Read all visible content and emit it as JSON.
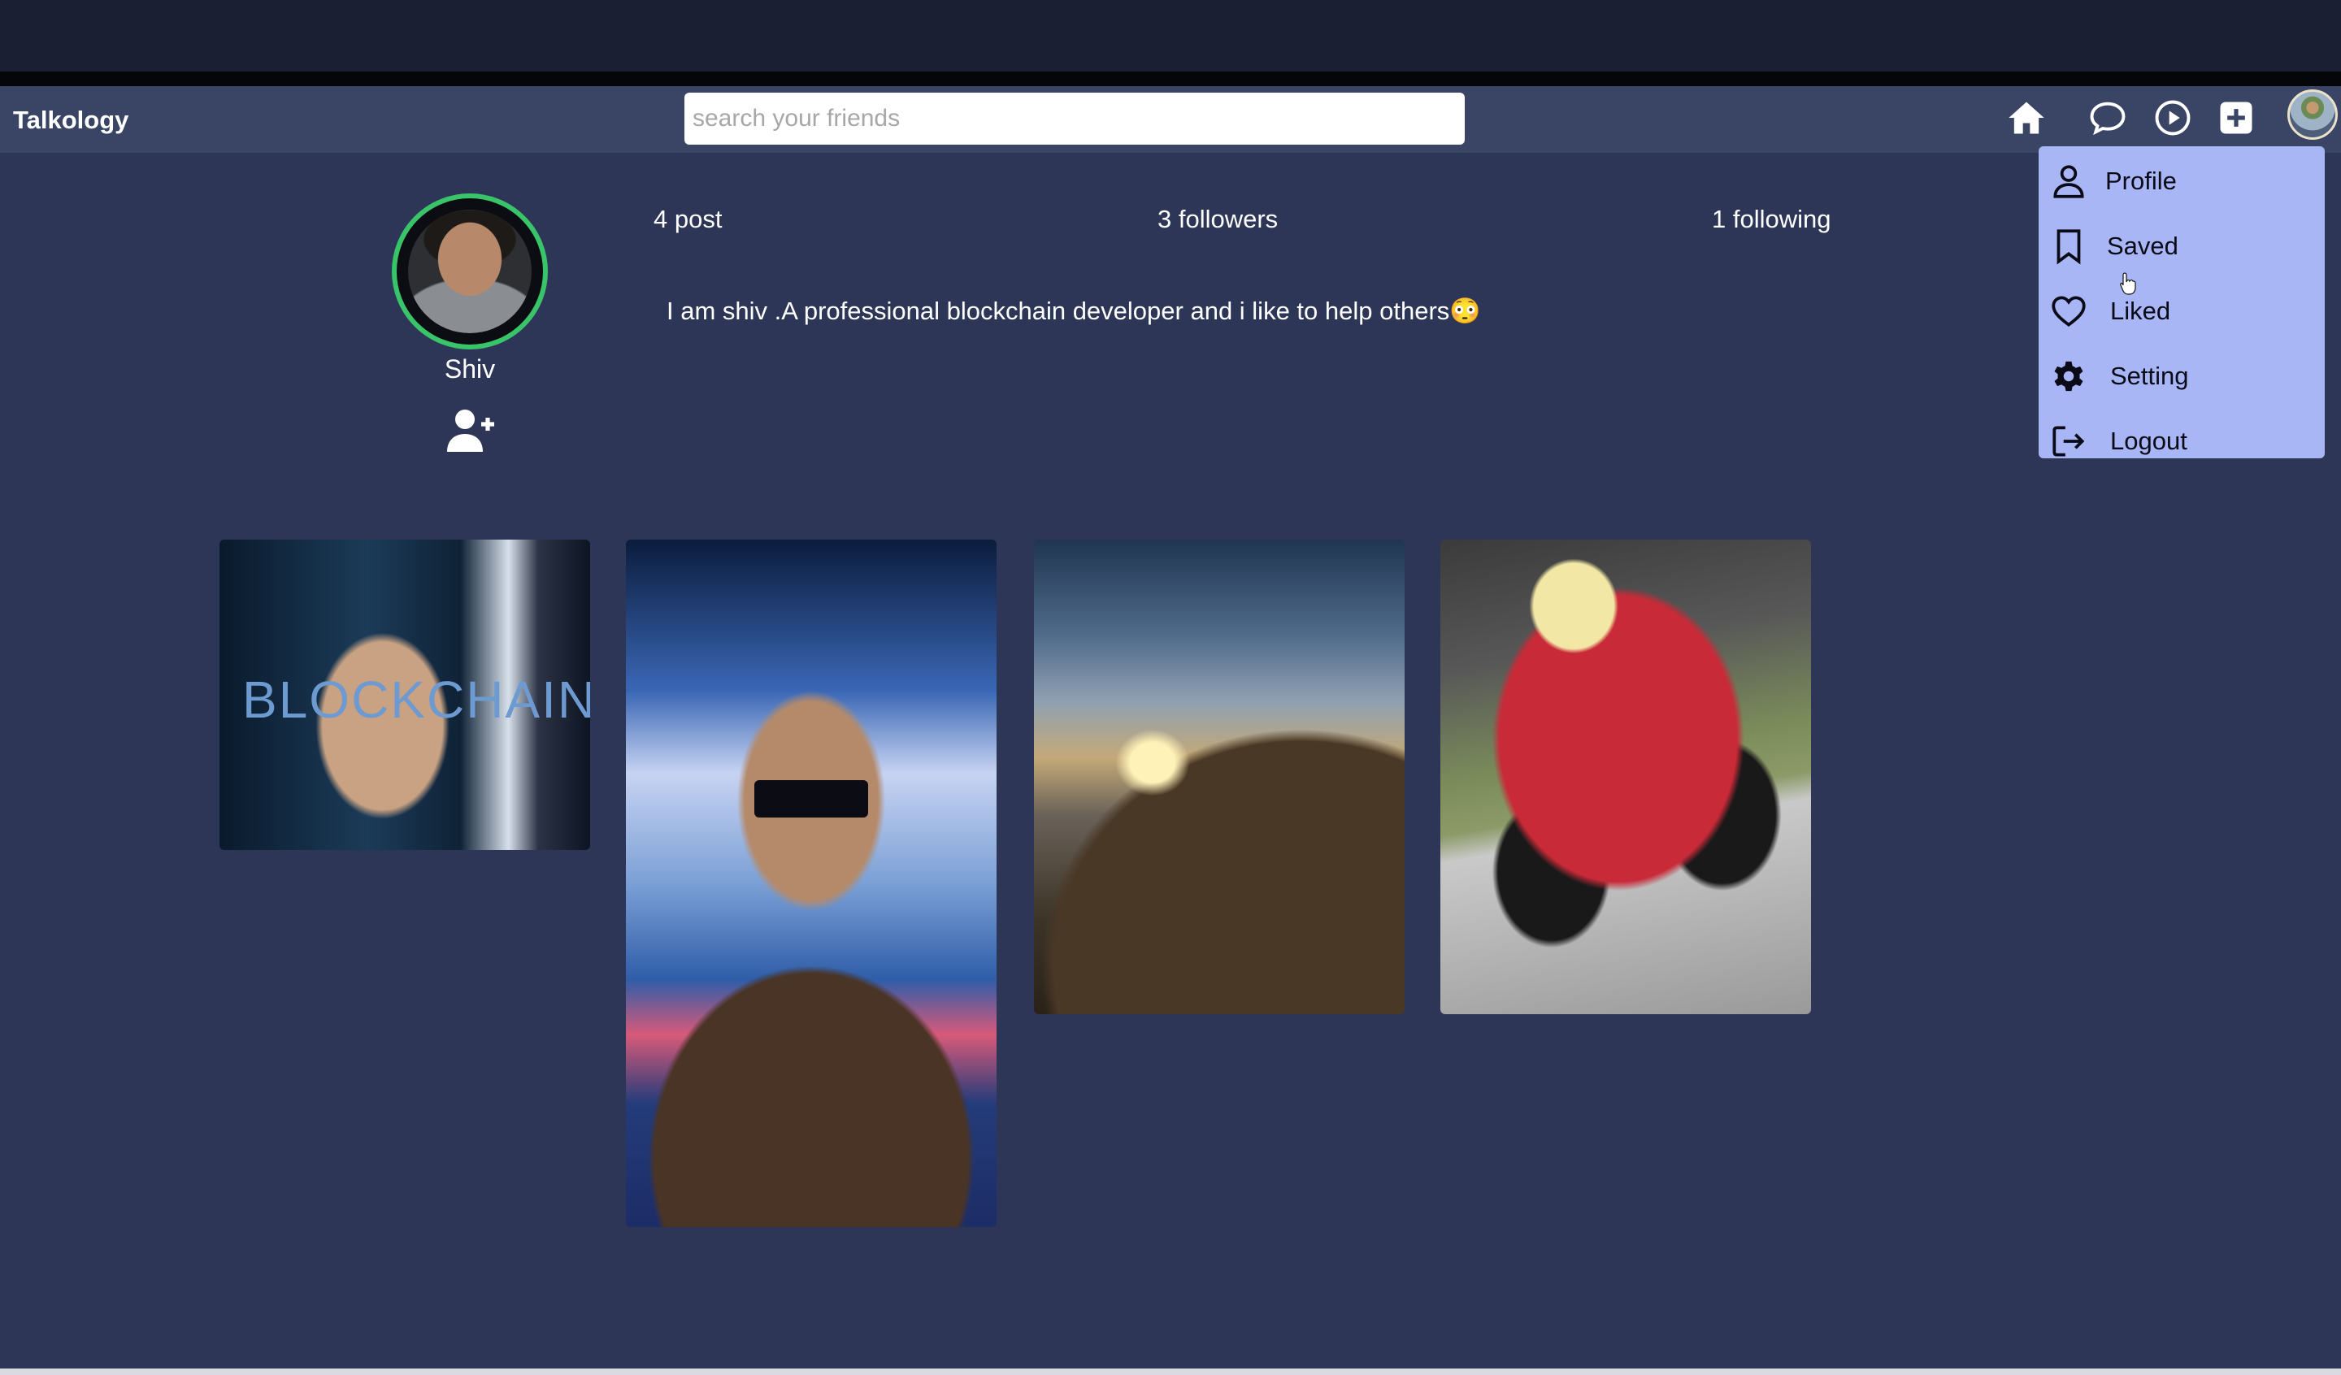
{
  "app": {
    "brand": "Talkology"
  },
  "search": {
    "placeholder": "search your friends",
    "value": ""
  },
  "nav": {
    "icons": [
      "home-icon",
      "chat-icon",
      "play-icon",
      "add-post-icon"
    ],
    "avatar": "user-avatar"
  },
  "menu": {
    "items": [
      {
        "label": "Profile",
        "icon": "user-icon"
      },
      {
        "label": "Saved",
        "icon": "bookmark-icon"
      },
      {
        "label": "Liked",
        "icon": "heart-icon"
      },
      {
        "label": "Setting",
        "icon": "gear-icon"
      },
      {
        "label": "Logout",
        "icon": "logout-icon"
      }
    ]
  },
  "profile": {
    "name": "Shiv",
    "posts": "4 post",
    "followers": "3 followers",
    "following": "1 following",
    "bio": "I am shiv .A professional blockchain developer and i like to help others😳",
    "follow_icon": "add-friend-icon"
  },
  "posts": [
    {
      "caption": "BLOCKCHAIN"
    },
    {},
    {},
    {}
  ],
  "colors": {
    "background": "#2d3656",
    "navbar": "#3a4464",
    "menu": "#a9b6f5",
    "avatar_ring": "#39c46a"
  }
}
